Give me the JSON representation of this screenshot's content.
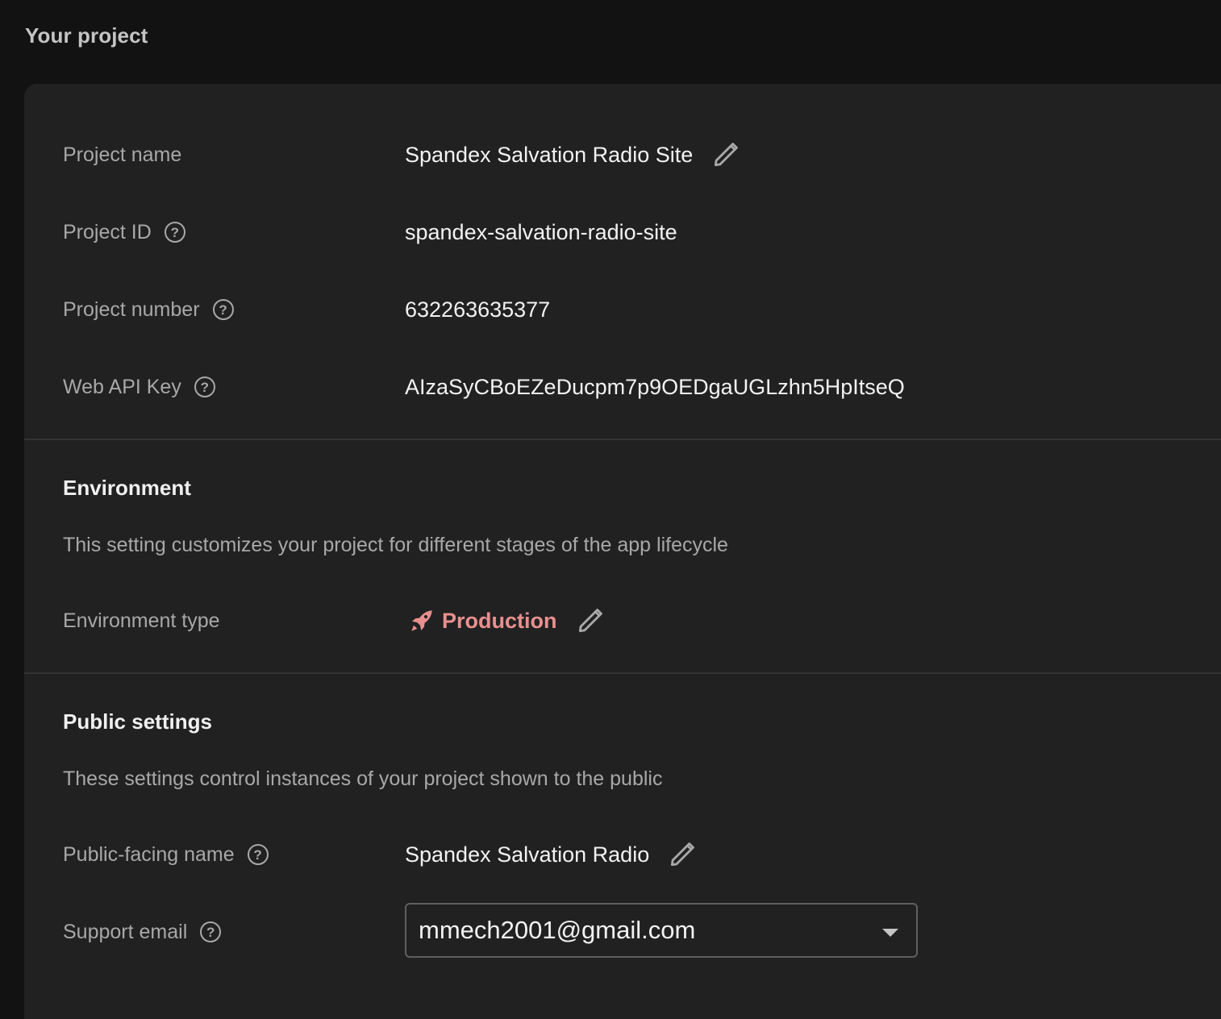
{
  "header": {
    "title": "Your project"
  },
  "project": {
    "name_label": "Project name",
    "name_value": "Spandex Salvation Radio Site",
    "id_label": "Project ID",
    "id_value": "spandex-salvation-radio-site",
    "number_label": "Project number",
    "number_value": "632263635377",
    "api_key_label": "Web API Key",
    "api_key_value": "AIzaSyCBoEZeDucpm7p9OEDgaUGLzhn5HpItseQ"
  },
  "environment": {
    "title": "Environment",
    "description": "This setting customizes your project for different stages of the app lifecycle",
    "type_label": "Environment type",
    "type_value": "Production",
    "type_icon": "rocket-icon",
    "type_color": "#e8908f"
  },
  "public_settings": {
    "title": "Public settings",
    "description": "These settings control instances of your project shown to the public",
    "public_name_label": "Public-facing name",
    "public_name_value": "Spandex Salvation Radio",
    "support_email_label": "Support email",
    "support_email_value": "mmech2001@gmail.com"
  },
  "icons": {
    "help": "?",
    "edit": "pencil-icon",
    "dropdown": "caret-down-icon"
  }
}
